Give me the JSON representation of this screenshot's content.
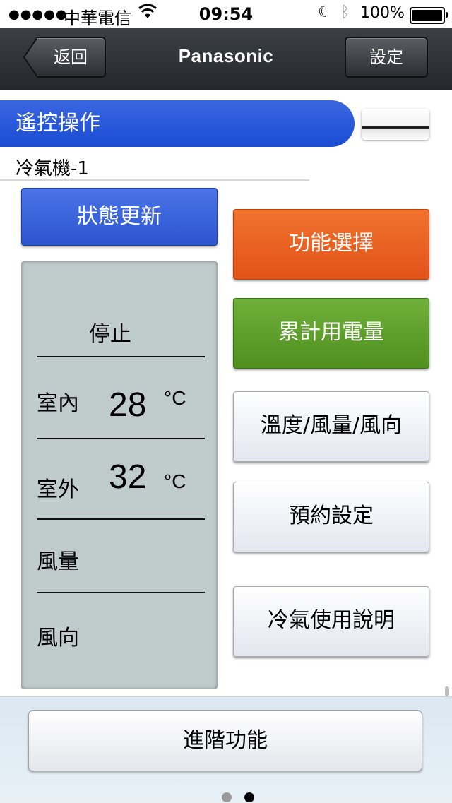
{
  "status_bar": {
    "signal": "●●●●●",
    "carrier": "中華電信",
    "time": "09:54",
    "battery_text": "100%"
  },
  "nav": {
    "back_label": "返回",
    "title": "Panasonic",
    "settings_label": "設定"
  },
  "header": {
    "section_title": "遙控操作",
    "device_name": "冷氣機-1"
  },
  "left": {
    "refresh_label": "狀態更新",
    "panel": {
      "state": "停止",
      "indoor_label": "室內",
      "indoor_temp": "28",
      "indoor_unit": "°C",
      "outdoor_label": "室外",
      "outdoor_temp": "32",
      "outdoor_unit": "°C",
      "fan_label": "風量",
      "direction_label": "風向"
    }
  },
  "menu": {
    "function_select": "功能選擇",
    "power_usage": "累計用電量",
    "temp_fan_dir": "溫度/風量/風向",
    "timer_setting": "預約設定",
    "cooling_help": "冷氣使用說明"
  },
  "bottom": {
    "advanced_label": "進階功能"
  },
  "pager": {
    "pages": 2,
    "current": 2
  },
  "colors": {
    "section_blue": "#1a4cd2",
    "orange": "#e2531a",
    "green": "#4f901f",
    "panel_gray": "#c0cbcb"
  },
  "icons": {
    "wifi": "wifi-icon",
    "moon": "moon-icon",
    "bluetooth": "bluetooth-icon",
    "battery": "battery-icon",
    "back_arrow": "back-arrow-icon"
  }
}
